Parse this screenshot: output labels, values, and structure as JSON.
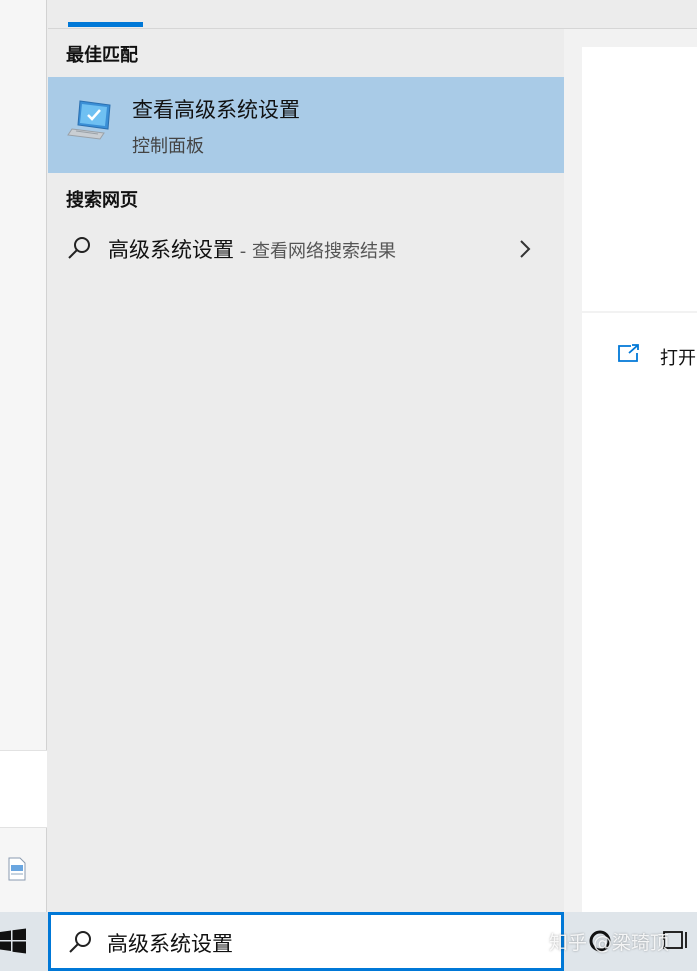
{
  "panel": {
    "best_match_heading": "最佳匹配",
    "best_match": {
      "title": "查看高级系统设置",
      "subtitle": "控制面板",
      "icon": "computer-settings-icon"
    },
    "web_heading": "搜索网页",
    "web_result": {
      "query": "高级系统设置",
      "suffix": " - 查看网络搜索结果",
      "icon": "search-icon",
      "chevron": "chevron-right-icon"
    }
  },
  "preview": {
    "open_label": "打开",
    "open_icon": "open-external-icon"
  },
  "taskbar": {
    "search_value": "高级系统设置",
    "search_icon": "search-icon",
    "watermark": "知乎 @梁琦顶"
  },
  "colors": {
    "accent": "#0078d7",
    "selected_row": "#a9cbe7",
    "panel_bg": "#ececec"
  }
}
